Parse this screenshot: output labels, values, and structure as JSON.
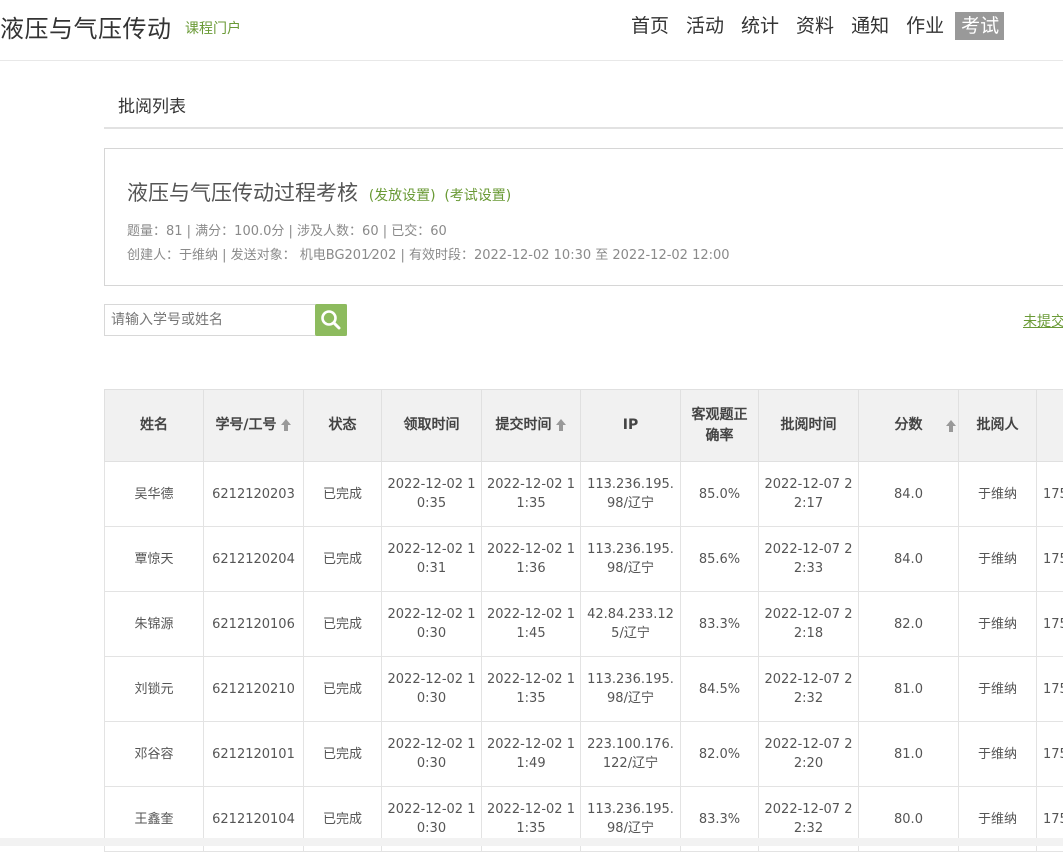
{
  "header": {
    "title": "液压与气压传动",
    "subtitle": "课程门户",
    "nav": [
      "首页",
      "活动",
      "统计",
      "资料",
      "通知",
      "作业",
      "考试"
    ],
    "active_nav": "考试"
  },
  "page": {
    "section_title": "批阅列表"
  },
  "exam": {
    "name": "液压与气压传动过程考核",
    "release_settings": "(发放设置)",
    "exam_settings": "(考试设置)",
    "stats_line": "题量：81 |  满分：100.0分 |  涉及人数：60 | 已交：60",
    "creator_line": "创建人：于维纳 | 发送对象： 机电BG201⁄202  |  有效时段：2022-12-02 10:30 至 2022-12-02 12:00"
  },
  "search": {
    "placeholder": "请输入学号或姓名",
    "value": ""
  },
  "links": {
    "unsubmitted": "未提交"
  },
  "table": {
    "headers": [
      "姓名",
      "学号/工号",
      "状态",
      "领取时间",
      "提交时间",
      "IP",
      "客观题正确率",
      "批阅时间",
      "分数",
      "批阅人",
      ""
    ],
    "rows": [
      {
        "name": "吴华德",
        "id": "6212120203",
        "status": "已完成",
        "get_time": "2022-12-02 10:35",
        "submit_time": "2022-12-02 11:35",
        "ip": "113.236.195.98/辽宁",
        "accuracy": "85.0%",
        "review_time": "2022-12-07 22:17",
        "score": "84.0",
        "reviewer": "于维纳",
        "extra": "175"
      },
      {
        "name": "覃惊天",
        "id": "6212120204",
        "status": "已完成",
        "get_time": "2022-12-02 10:31",
        "submit_time": "2022-12-02 11:36",
        "ip": "113.236.195.98/辽宁",
        "accuracy": "85.6%",
        "review_time": "2022-12-07 22:33",
        "score": "84.0",
        "reviewer": "于维纳",
        "extra": "175"
      },
      {
        "name": "朱锦源",
        "id": "6212120106",
        "status": "已完成",
        "get_time": "2022-12-02 10:30",
        "submit_time": "2022-12-02 11:45",
        "ip": "42.84.233.125/辽宁",
        "accuracy": "83.3%",
        "review_time": "2022-12-07 22:18",
        "score": "82.0",
        "reviewer": "于维纳",
        "extra": "175"
      },
      {
        "name": "刘锁元",
        "id": "6212120210",
        "status": "已完成",
        "get_time": "2022-12-02 10:30",
        "submit_time": "2022-12-02 11:35",
        "ip": "113.236.195.98/辽宁",
        "accuracy": "84.5%",
        "review_time": "2022-12-07 22:32",
        "score": "81.0",
        "reviewer": "于维纳",
        "extra": "175"
      },
      {
        "name": "邓谷容",
        "id": "6212120101",
        "status": "已完成",
        "get_time": "2022-12-02 10:30",
        "submit_time": "2022-12-02 11:49",
        "ip": "223.100.176.122/辽宁",
        "accuracy": "82.0%",
        "review_time": "2022-12-07 22:20",
        "score": "81.0",
        "reviewer": "于维纳",
        "extra": "175"
      },
      {
        "name": "王鑫奎",
        "id": "6212120104",
        "status": "已完成",
        "get_time": "2022-12-02 10:30",
        "submit_time": "2022-12-02 11:35",
        "ip": "113.236.195.98/辽宁",
        "accuracy": "83.3%",
        "review_time": "2022-12-07 22:32",
        "score": "80.0",
        "reviewer": "于维纳",
        "extra": "175"
      }
    ]
  },
  "colors": {
    "accent_green": "#6a9a36",
    "search_button": "#8dbb5e",
    "active_tab_bg": "#999999",
    "table_header_bg": "#f1f1f1"
  }
}
